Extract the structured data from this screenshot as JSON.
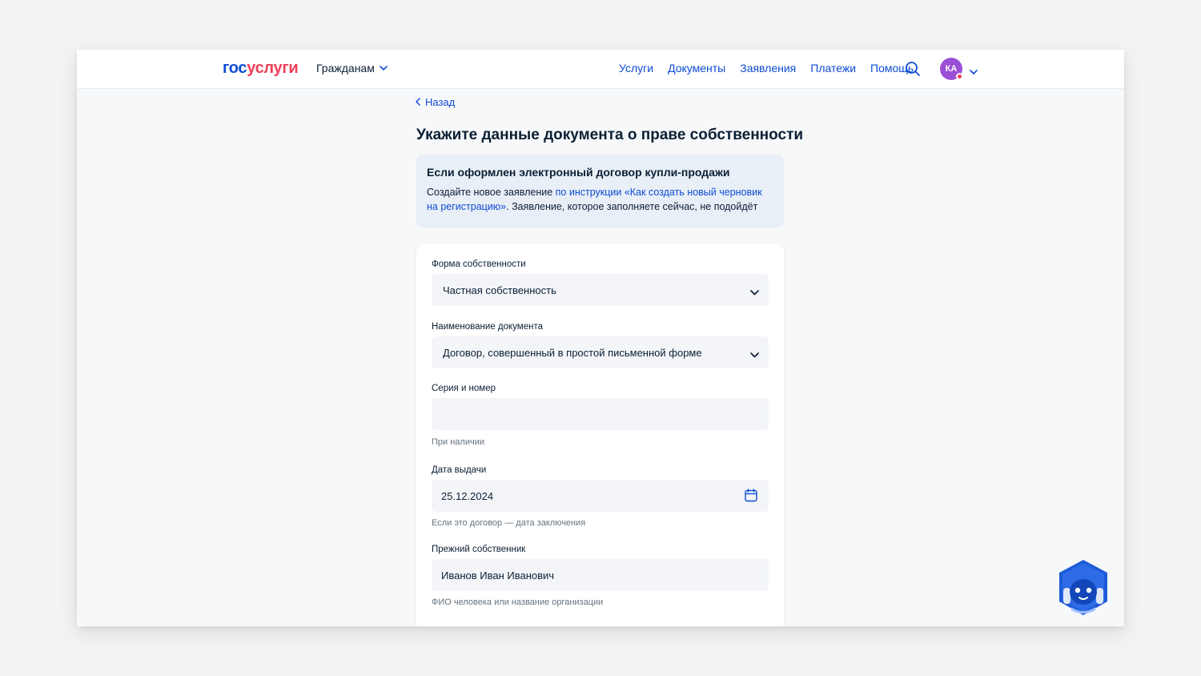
{
  "header": {
    "logo_part1": "гос",
    "logo_part2": "услуги",
    "audience": "Гражданам",
    "nav": [
      "Услуги",
      "Документы",
      "Заявления",
      "Платежи",
      "Помощь"
    ],
    "avatar_initials": "КА"
  },
  "back_label": "Назад",
  "page_title": "Укажите данные документа о праве собственности",
  "notice": {
    "title": "Если оформлен электронный договор купли-продажи",
    "text_before": "Создайте новое заявление ",
    "link": "по инструкции «Как создать новый черновик на регистрацию»",
    "text_after": ". Заявление, которое заполняете сейчас, не подойдёт"
  },
  "form": {
    "ownership_label": "Форма собственности",
    "ownership_value": "Частная собственность",
    "doc_name_label": "Наименование документа",
    "doc_name_value": "Договор, совершенный в простой письменной форме",
    "series_label": "Серия и номер",
    "series_value": "",
    "series_hint": "При наличии",
    "issue_date_label": "Дата выдачи",
    "issue_date_value": "25.12.2024",
    "issue_date_hint": "Если это договор — дата заключения",
    "prev_owner_label": "Прежний собственник",
    "prev_owner_value": "Иванов Иван Иванович",
    "prev_owner_hint": "ФИО человека или название организации"
  },
  "colors": {
    "brand_blue": "#0d4cd3",
    "brand_red": "#ee3f58",
    "avatar": "#9b4fd6"
  }
}
